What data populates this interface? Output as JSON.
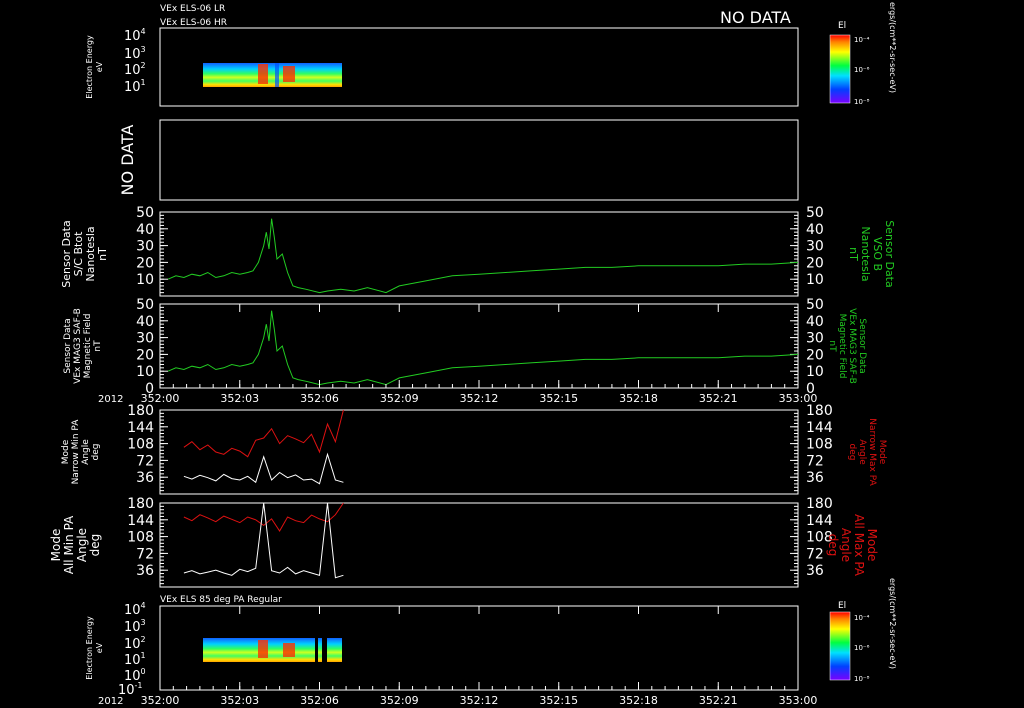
{
  "header": {
    "line1": "VEx ELS-06 LR",
    "line2": "VEx ELS-06 HR",
    "no_data_top": "NO DATA"
  },
  "panel1": {
    "ylabel": [
      "Electron Energy",
      "eV"
    ],
    "colorbar_label": "El",
    "colorbar_ticks": [
      "10⁻⁴",
      "10⁻⁶",
      "10⁻⁸"
    ],
    "colorbar_units": "ergs/(cm**2-sr-sec-eV)"
  },
  "panel2": {
    "no_data": "NO DATA"
  },
  "panel3": {
    "left_label": [
      "Sensor Data",
      "S/C Btot",
      "Nanotesla",
      "nT"
    ],
    "right_label": [
      "Sensor Data",
      "VSO B",
      "Nanotesla",
      "nT"
    ]
  },
  "panel4": {
    "left_label": [
      "Sensor Data",
      "VEx MAG3 SAF-B",
      "Magnetic Field",
      "nT"
    ],
    "right_label": [
      "Sensor Data",
      "VEx MAG3 SAF-B",
      "Magnetic Field",
      "nT"
    ]
  },
  "panel5": {
    "left_label": [
      "Mode",
      "Narrow Min PA",
      "Angle",
      "deg"
    ],
    "right_label": [
      "Mode",
      "Narrow Max PA",
      "Angle",
      "deg"
    ]
  },
  "panel6": {
    "left_label": [
      "Mode",
      "All Min PA",
      "Angle",
      "deg"
    ],
    "right_label": [
      "Mode",
      "All Max PA",
      "Angle",
      "deg"
    ]
  },
  "panel7": {
    "title": "VEx ELS 85 deg PA Regular",
    "ylabel": [
      "Electron Energy",
      "eV"
    ],
    "colorbar_label": "El",
    "colorbar_ticks": [
      "10⁻⁴",
      "10⁻⁶",
      "10⁻⁸"
    ],
    "colorbar_units": "ergs/(cm**2-sr-sec-eV)"
  },
  "x_axis": {
    "year": "2012",
    "ticks": [
      "352:00",
      "352:03",
      "352:06",
      "352:09",
      "352:12",
      "352:15",
      "352:18",
      "352:21",
      "353:00"
    ]
  },
  "colors": {
    "btot": "#22cc22",
    "min_pa": "#ffffff",
    "max_pa": "#dd1111"
  },
  "chart_data": [
    {
      "type": "heatmap",
      "title": "VEx ELS-06 LR",
      "x_range": [
        "352:00",
        "353:00"
      ],
      "y_scale": "log",
      "yticks": [
        "10⁴",
        "10³",
        "10²",
        "10¹"
      ],
      "data_extent_x": [
        "352:01.2",
        "352:06.9"
      ],
      "data_extent_y_eV": [
        5,
        200
      ]
    },
    {
      "type": "line",
      "series": [
        {
          "name": "S/C Btot",
          "x": [
            0.3,
            0.6,
            0.9,
            1.2,
            1.5,
            1.8,
            2.1,
            2.4,
            2.7,
            3.0,
            3.3,
            3.5,
            3.7,
            3.9,
            4.0,
            4.1,
            4.2,
            4.3,
            4.4,
            4.6,
            4.8,
            5.0,
            5.2,
            5.5,
            6.0,
            6.3,
            6.8,
            7.3,
            7.8,
            8.5,
            9.0,
            10,
            11,
            12,
            13,
            14,
            15,
            16,
            17,
            18,
            19,
            20,
            21,
            22,
            23,
            24
          ],
          "y": [
            10,
            12,
            11,
            13,
            12,
            14,
            11,
            12,
            14,
            13,
            14,
            15,
            20,
            30,
            38,
            28,
            46,
            35,
            22,
            25,
            14,
            6,
            5,
            4,
            2,
            3,
            4,
            3,
            5,
            2,
            6,
            9,
            12,
            13,
            14,
            15,
            16,
            17,
            17,
            18,
            18,
            18,
            18,
            19,
            19,
            20
          ]
        }
      ],
      "ylim": [
        0,
        50
      ],
      "yticks": [
        10,
        20,
        30,
        40,
        50
      ]
    },
    {
      "type": "line",
      "series": [
        {
          "name": "VEx MAG3 SAF-B",
          "x": [
            0.3,
            0.6,
            0.9,
            1.2,
            1.5,
            1.8,
            2.1,
            2.4,
            2.7,
            3.0,
            3.3,
            3.5,
            3.7,
            3.9,
            4.0,
            4.1,
            4.2,
            4.3,
            4.4,
            4.6,
            4.8,
            5.0,
            5.2,
            5.5,
            6.0,
            6.3,
            6.8,
            7.3,
            7.8,
            8.5,
            9.0,
            10,
            11,
            12,
            13,
            14,
            15,
            16,
            17,
            18,
            19,
            20,
            21,
            22,
            23,
            24
          ],
          "y": [
            10,
            12,
            11,
            13,
            12,
            14,
            11,
            12,
            14,
            13,
            14,
            15,
            20,
            30,
            38,
            28,
            46,
            35,
            22,
            25,
            14,
            6,
            5,
            4,
            2,
            3,
            4,
            3,
            5,
            2,
            6,
            9,
            12,
            13,
            14,
            15,
            16,
            17,
            17,
            18,
            18,
            18,
            18,
            19,
            19,
            20
          ]
        }
      ],
      "ylim": [
        0,
        50
      ],
      "yticks": [
        0,
        10,
        20,
        30,
        40,
        50
      ]
    },
    {
      "type": "line",
      "series": [
        {
          "name": "Narrow Min PA",
          "x": [
            0.9,
            1.2,
            1.5,
            1.8,
            2.1,
            2.4,
            2.7,
            3.0,
            3.3,
            3.6,
            3.9,
            4.2,
            4.5,
            4.8,
            5.1,
            5.4,
            5.7,
            6.0,
            6.3,
            6.6,
            6.9
          ],
          "y": [
            38,
            32,
            40,
            35,
            28,
            42,
            33,
            30,
            38,
            25,
            80,
            30,
            46,
            35,
            41,
            30,
            32,
            22,
            85,
            30,
            25
          ]
        },
        {
          "name": "Narrow Max PA",
          "x": [
            0.9,
            1.2,
            1.5,
            1.8,
            2.1,
            2.4,
            2.7,
            3.0,
            3.3,
            3.6,
            3.9,
            4.2,
            4.5,
            4.8,
            5.1,
            5.4,
            5.7,
            6.0,
            6.3,
            6.6,
            6.9
          ],
          "y": [
            100,
            112,
            95,
            105,
            90,
            85,
            98,
            92,
            80,
            115,
            120,
            140,
            108,
            125,
            118,
            110,
            128,
            90,
            150,
            112,
            180
          ]
        }
      ],
      "ylim": [
        0,
        180
      ],
      "yticks": [
        36,
        72,
        108,
        144,
        180
      ]
    },
    {
      "type": "line",
      "series": [
        {
          "name": "All Min PA",
          "x": [
            0.9,
            1.2,
            1.5,
            1.8,
            2.1,
            2.4,
            2.7,
            3.0,
            3.3,
            3.6,
            3.9,
            4.2,
            4.5,
            4.8,
            5.1,
            5.4,
            5.7,
            6.0,
            6.3,
            6.6,
            6.9
          ],
          "y": [
            30,
            35,
            28,
            32,
            36,
            30,
            25,
            38,
            33,
            40,
            180,
            35,
            30,
            42,
            28,
            35,
            30,
            25,
            180,
            20,
            25
          ]
        },
        {
          "name": "All Max PA",
          "x": [
            0.9,
            1.2,
            1.5,
            1.8,
            2.1,
            2.4,
            2.7,
            3.0,
            3.3,
            3.6,
            3.9,
            4.2,
            4.5,
            4.8,
            5.1,
            5.4,
            5.7,
            6.0,
            6.3,
            6.6,
            6.9
          ],
          "y": [
            150,
            142,
            155,
            148,
            140,
            152,
            145,
            138,
            150,
            144,
            132,
            146,
            120,
            150,
            142,
            138,
            154,
            146,
            140,
            155,
            180
          ]
        }
      ],
      "ylim": [
        0,
        180
      ],
      "yticks": [
        36,
        72,
        108,
        144,
        180
      ]
    },
    {
      "type": "heatmap",
      "title": "VEx ELS 85 deg PA Regular",
      "x_range": [
        "352:00",
        "353:00"
      ],
      "y_scale": "log",
      "yticks": [
        "10⁴",
        "10³",
        "10²",
        "10¹",
        "10⁰",
        "10⁻¹"
      ],
      "data_extent_x": [
        "352:01.2",
        "352:06.9"
      ],
      "data_extent_y_eV": [
        5,
        200
      ]
    }
  ]
}
